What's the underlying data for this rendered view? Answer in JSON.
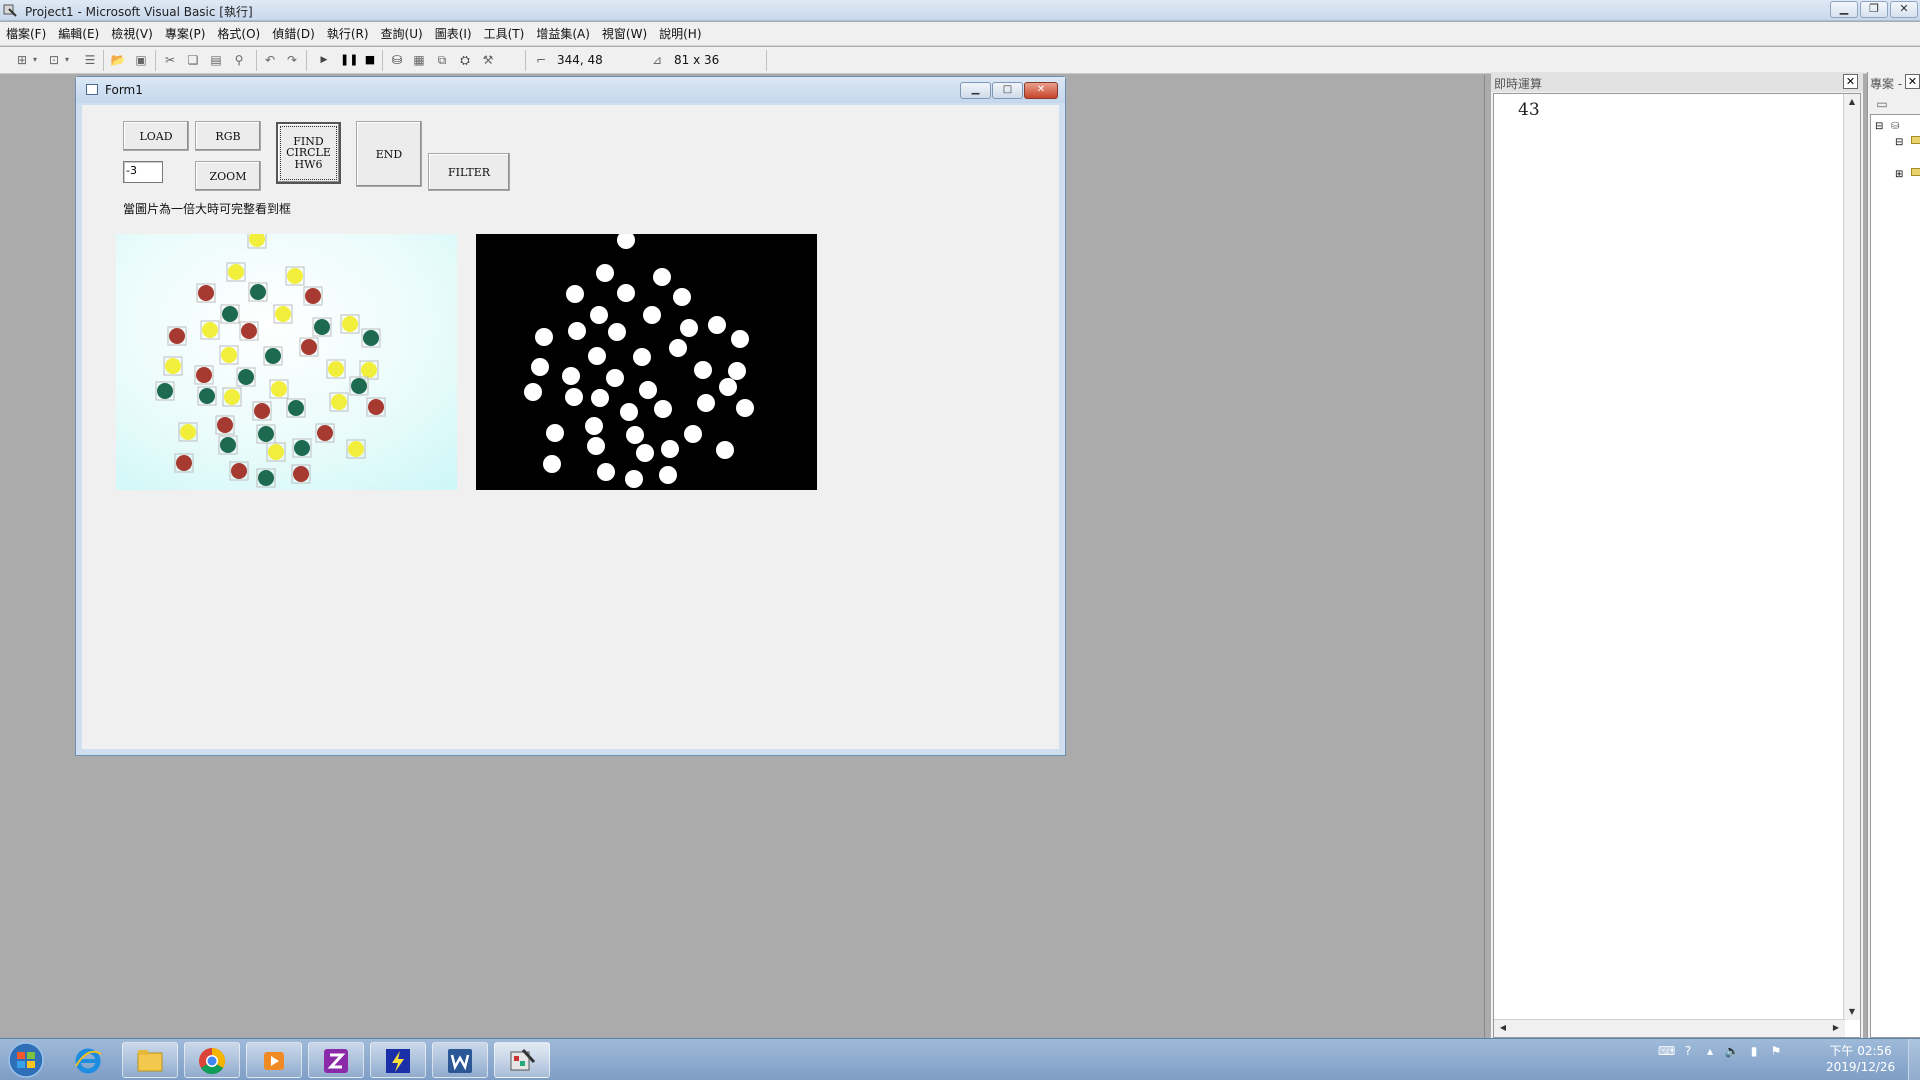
{
  "window": {
    "title": "Project1 - Microsoft Visual Basic [執行]",
    "minimize": "▁",
    "restore": "❐",
    "close": "✕"
  },
  "menu": [
    "檔案(F)",
    "編輯(E)",
    "檢視(V)",
    "專案(P)",
    "格式(O)",
    "偵錯(D)",
    "執行(R)",
    "查詢(U)",
    "圖表(I)",
    "工具(T)",
    "增益集(A)",
    "視窗(W)",
    "說明(H)"
  ],
  "toolbar": {
    "position": "344, 48",
    "size": "81 x 36"
  },
  "form": {
    "title": "Form1",
    "minimize": "▁",
    "maximize": "□",
    "close": "✕",
    "buttons": {
      "load": "LOAD",
      "rgb": "RGB",
      "zoom": "ZOOM",
      "find_line1": "FIND",
      "find_line2": "CIRCLE",
      "find_line3": "HW6",
      "end": "END",
      "filter": "FILTER"
    },
    "textbox_value": "-3",
    "note": "當圖片為一倍大時可完整看到框",
    "colors": {
      "red": "#a63a30",
      "green": "#1e6a50",
      "yellow": "#f2ee3c",
      "picture_bg": "#e9fbfb"
    }
  },
  "immediate": {
    "title": "即時運算",
    "output": "43",
    "close": "✕"
  },
  "project": {
    "title": "專案 -",
    "close": "✕"
  },
  "taskbar": {
    "apps": [
      "internet-explorer",
      "file-explorer",
      "chrome",
      "media-player",
      "app-z",
      "app-flash",
      "word",
      "vb6"
    ],
    "time": "下午 02:56",
    "date": "2019/12/26"
  }
}
